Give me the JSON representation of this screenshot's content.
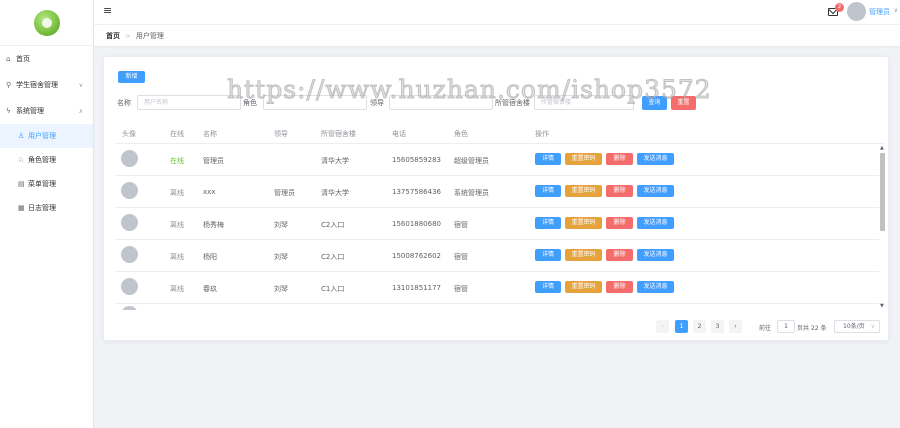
{
  "sidebar": {
    "items": [
      {
        "label": "首页",
        "icon": "home-icon"
      },
      {
        "label": "学生宿舍管理",
        "icon": "link-icon"
      },
      {
        "label": "系统管理",
        "icon": "lightning-icon"
      }
    ],
    "sub_items": [
      {
        "label": "用户管理",
        "icon": "user-icon",
        "active": true
      },
      {
        "label": "角色管理",
        "icon": "users-icon"
      },
      {
        "label": "菜单管理",
        "icon": "menu-icon"
      },
      {
        "label": "日志管理",
        "icon": "log-icon"
      }
    ]
  },
  "header": {
    "badge_count": "2",
    "user_name": "管理员"
  },
  "breadcrumb": {
    "home": "首页",
    "separator": ">",
    "current": "用户管理"
  },
  "toolbar": {
    "add_label": "新增"
  },
  "search": {
    "name_label": "名称",
    "name_placeholder": "用户名称",
    "role_label": "角色",
    "leader_label": "领导",
    "dorm_label": "所管宿舍楼",
    "dorm_placeholder": "所管宿舍楼",
    "search_label": "查询",
    "reset_label": "重置"
  },
  "table": {
    "columns": [
      "头像",
      "在线",
      "名称",
      "领导",
      "所管宿舍楼",
      "电话",
      "角色",
      "操作"
    ],
    "rows": [
      {
        "online": "在线",
        "name": "管理员",
        "leader": "",
        "dorm": "清华大学",
        "phone": "15605859283",
        "role": "超级管理员"
      },
      {
        "online": "离线",
        "name": "xxx",
        "leader": "管理员",
        "dorm": "清华大学",
        "phone": "13757586436",
        "role": "系统管理员"
      },
      {
        "online": "离线",
        "name": "杨秀梅",
        "leader": "刘琴",
        "dorm": "C2入口",
        "phone": "15601880680",
        "role": "宿管"
      },
      {
        "online": "离线",
        "name": "杨阳",
        "leader": "刘琴",
        "dorm": "C2入口",
        "phone": "15008762602",
        "role": "宿管"
      },
      {
        "online": "离线",
        "name": "春玖",
        "leader": "刘琴",
        "dorm": "C1入口",
        "phone": "13101851177",
        "role": "宿管"
      }
    ],
    "actions": {
      "detail": "详情",
      "reset_password": "重置密码",
      "delete": "删除",
      "send_message": "发送消息"
    }
  },
  "pagination": {
    "pages": [
      "1",
      "2",
      "3"
    ],
    "current_page": "1",
    "prev": "‹",
    "next": "›",
    "goto_label": "前往",
    "goto_value": "1",
    "total_text": "页共 22 条",
    "page_size": "10条/页"
  },
  "watermark": "https://www.huzhan.com/ishop3572",
  "colors": {
    "primary": "#409eff",
    "danger": "#f56c6c",
    "warning": "#e6a23c",
    "success": "#67c23a"
  }
}
